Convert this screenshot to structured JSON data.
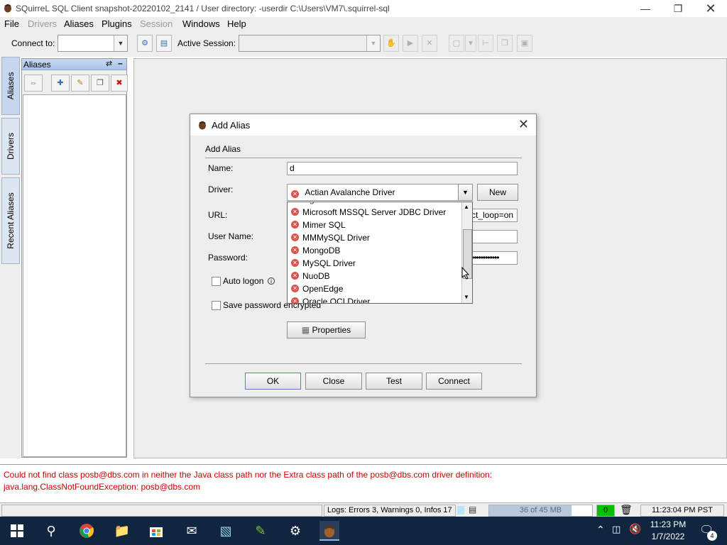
{
  "window": {
    "title": "SQuirreL SQL Client snapshot-20220102_2141 / User directory: -userdir C:\\Users\\VM7\\.squirrel-sql"
  },
  "menubar": {
    "items": [
      {
        "label": "File",
        "enabled": true
      },
      {
        "label": "Drivers",
        "enabled": false
      },
      {
        "label": "Aliases",
        "enabled": true
      },
      {
        "label": "Plugins",
        "enabled": true
      },
      {
        "label": "Session",
        "enabled": false
      },
      {
        "label": "Windows",
        "enabled": true
      },
      {
        "label": "Help",
        "enabled": true
      }
    ]
  },
  "toolbar": {
    "connect_to_label": "Connect to:",
    "connect_to_value": "",
    "active_session_label": "Active Session:",
    "active_session_value": ""
  },
  "left_tabs": [
    "Aliases",
    "Drivers",
    "Recent Aliases"
  ],
  "aliases_panel": {
    "title": "Aliases"
  },
  "dialog": {
    "title": "Add Alias",
    "group_label": "Add Alias",
    "name_label": "Name:",
    "name_value": "d",
    "driver_label": "Driver:",
    "driver_value": "Actian Avalanche Driver",
    "new_button": "New",
    "url_label": "URL:",
    "url_value_visible": "ct_loop=on",
    "username_label": "User Name:",
    "username_value": "",
    "password_label": "Password:",
    "password_value": "••••••••••••",
    "auto_logon_label": "Auto logon",
    "auto_logon_checked": false,
    "save_password_label": "Save password encrypted",
    "save_password_checked": false,
    "properties_button": "Properties",
    "buttons": {
      "ok": "OK",
      "close": "Close",
      "test": "Test",
      "connect": "Connect"
    }
  },
  "driver_dropdown": {
    "items": [
      "Microsoft MSSQL Server JDBC Driver",
      "Mimer SQL",
      "MMMySQL Driver",
      "MongoDB",
      "MySQL Driver",
      "NuoDB",
      "OpenEdge",
      "Oracle OCI Driver"
    ],
    "scroll_position": 0.55
  },
  "messages": [
    "Could not find class posb@dbs.com in neither the Java class path nor the Extra class path of the posb@dbs.com driver definition:",
    "java.lang.ClassNotFoundException: posb@dbs.com"
  ],
  "statusbar": {
    "logs": "Logs: Errors 3, Warnings 0, Infos 17",
    "memory": "36 of 45 MB",
    "memory_fraction": 0.8,
    "sessions": "0",
    "time": "11:23:04 PM PST"
  },
  "taskbar": {
    "time": "11:23 PM",
    "date": "1/7/2022",
    "notification_count": "4"
  },
  "colors": {
    "error_text": "#cc0000",
    "taskbar": "#10253f",
    "panel_header": "#a9c3e6",
    "session_count_bg": "#00c000"
  }
}
